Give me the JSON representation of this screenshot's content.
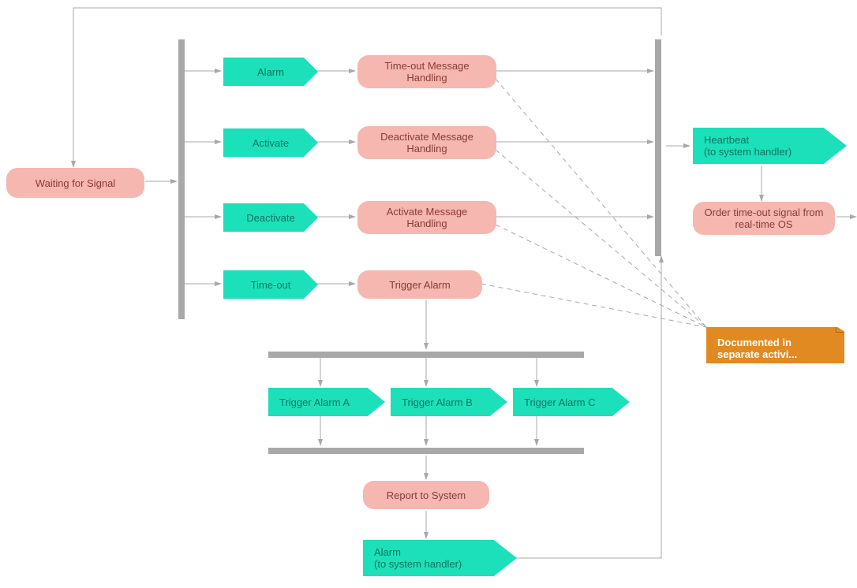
{
  "nodes": {
    "waiting": "Waiting for Signal",
    "alarm": "Alarm",
    "activate": "Activate",
    "deactivate": "Deactivate",
    "timeout": "Time-out",
    "timeoutHandling": "Time-out Message Handling",
    "deactivateHandling": "Deactivate Message Handling",
    "activateHandling": "Activate Message Handling",
    "triggerAlarm": "Trigger Alarm",
    "triggerA": "Trigger Alarm A",
    "triggerB": "Trigger Alarm B",
    "triggerC": "Trigger Alarm C",
    "report": "Report to System",
    "alarmOut": "Alarm\n(to system handler)",
    "heartbeat": "Heartbeat\n(to system handler)",
    "orderTimeout": "Order time-out signal from real-time OS",
    "note": "Documented in separate activi..."
  }
}
